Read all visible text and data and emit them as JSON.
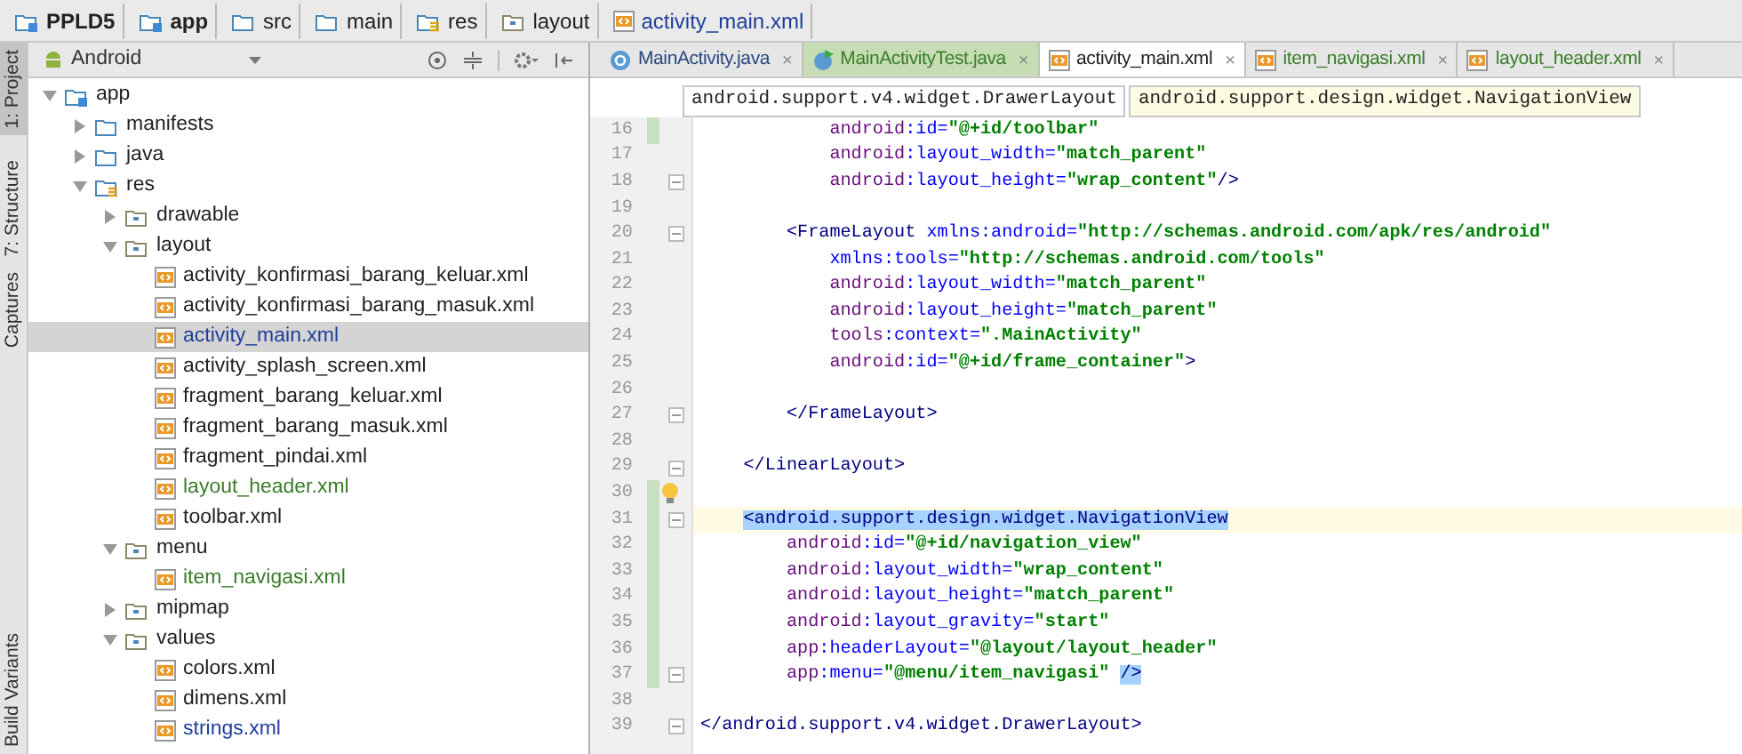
{
  "breadcrumb": [
    {
      "label": "PPLD5",
      "kind": "module"
    },
    {
      "label": "app",
      "kind": "module"
    },
    {
      "label": "src",
      "kind": "folder"
    },
    {
      "label": "main",
      "kind": "folder"
    },
    {
      "label": "res",
      "kind": "resdir"
    },
    {
      "label": "layout",
      "kind": "subdir"
    },
    {
      "label": "activity_main.xml",
      "kind": "xml"
    }
  ],
  "tool_strip": [
    {
      "label": "1: Project",
      "selected": true
    },
    {
      "label": "7: Structure",
      "selected": false
    },
    {
      "label": "Captures",
      "selected": false
    },
    {
      "label": "Build Variants",
      "selected": false
    }
  ],
  "project_panel": {
    "view": "Android",
    "tree": [
      {
        "label": "app",
        "kind": "module",
        "expanded": true,
        "selected": false,
        "color": "#222222",
        "children": [
          {
            "label": "manifests",
            "kind": "folder",
            "expanded": false,
            "selected": false,
            "color": "#222222"
          },
          {
            "label": "java",
            "kind": "folder",
            "expanded": false,
            "selected": false,
            "color": "#222222"
          },
          {
            "label": "res",
            "kind": "resdir",
            "expanded": true,
            "selected": false,
            "color": "#222222",
            "children": [
              {
                "label": "drawable",
                "kind": "subdir",
                "expanded": false,
                "selected": false,
                "color": "#222222"
              },
              {
                "label": "layout",
                "kind": "subdir",
                "expanded": true,
                "selected": false,
                "color": "#222222",
                "children": [
                  {
                    "label": "activity_konfirmasi_barang_keluar.xml",
                    "kind": "xml",
                    "selected": false,
                    "color": "#222222"
                  },
                  {
                    "label": "activity_konfirmasi_barang_masuk.xml",
                    "kind": "xml",
                    "selected": false,
                    "color": "#222222"
                  },
                  {
                    "label": "activity_main.xml",
                    "kind": "xml",
                    "selected": true,
                    "color": "#1f3f9b"
                  },
                  {
                    "label": "activity_splash_screen.xml",
                    "kind": "xml",
                    "selected": false,
                    "color": "#222222"
                  },
                  {
                    "label": "fragment_barang_keluar.xml",
                    "kind": "xml",
                    "selected": false,
                    "color": "#222222"
                  },
                  {
                    "label": "fragment_barang_masuk.xml",
                    "kind": "xml",
                    "selected": false,
                    "color": "#222222"
                  },
                  {
                    "label": "fragment_pindai.xml",
                    "kind": "xml",
                    "selected": false,
                    "color": "#222222"
                  },
                  {
                    "label": "layout_header.xml",
                    "kind": "xml",
                    "selected": false,
                    "color": "#3a7d2a"
                  },
                  {
                    "label": "toolbar.xml",
                    "kind": "xml",
                    "selected": false,
                    "color": "#222222"
                  }
                ]
              },
              {
                "label": "menu",
                "kind": "subdir",
                "expanded": true,
                "selected": false,
                "color": "#222222",
                "children": [
                  {
                    "label": "item_navigasi.xml",
                    "kind": "xml",
                    "selected": false,
                    "color": "#3a7d2a"
                  }
                ]
              },
              {
                "label": "mipmap",
                "kind": "subdir",
                "expanded": false,
                "selected": false,
                "color": "#222222"
              },
              {
                "label": "values",
                "kind": "subdir",
                "expanded": true,
                "selected": false,
                "color": "#222222",
                "children": [
                  {
                    "label": "colors.xml",
                    "kind": "xml",
                    "selected": false,
                    "color": "#222222"
                  },
                  {
                    "label": "dimens.xml",
                    "kind": "xml",
                    "selected": false,
                    "color": "#222222"
                  },
                  {
                    "label": "strings.xml",
                    "kind": "xml",
                    "selected": false,
                    "color": "#1f3f9b"
                  }
                ]
              }
            ]
          }
        ]
      }
    ]
  },
  "editor_tabs": [
    {
      "label": "MainActivity.java",
      "kind": "class",
      "color": "#2a4a80",
      "close": "×",
      "selected": false
    },
    {
      "label": "MainActivityTest.java",
      "kind": "test",
      "color": "#3a7d2a",
      "close": "×",
      "selected": false
    },
    {
      "label": "activity_main.xml",
      "kind": "xml",
      "color": "#222222",
      "close": "×",
      "selected": true
    },
    {
      "label": "item_navigasi.xml",
      "kind": "xml",
      "color": "#3a7d2a",
      "close": "×",
      "selected": false
    },
    {
      "label": "layout_header.xml",
      "kind": "xml",
      "color": "#3a7d2a",
      "close": "×",
      "selected": false
    }
  ],
  "tag_path": [
    {
      "label": "android.support.v4.widget.DrawerLayout",
      "selected": false
    },
    {
      "label": "android.support.design.widget.NavigationView",
      "selected": true
    }
  ],
  "code_lines": [
    {
      "number": "16",
      "changed": true,
      "fold": false,
      "current": false,
      "bulb": false,
      "tokens": [
        {
          "kind": "ns",
          "text": "            android",
          "selected": false
        },
        {
          "kind": "attr",
          "text": ":id=",
          "selected": false
        },
        {
          "kind": "value",
          "text": "\"@+id/toolbar\"",
          "selected": false
        }
      ]
    },
    {
      "number": "17",
      "changed": false,
      "fold": false,
      "current": false,
      "bulb": false,
      "tokens": [
        {
          "kind": "ns",
          "text": "            android",
          "selected": false
        },
        {
          "kind": "attr",
          "text": ":layout_width=",
          "selected": false
        },
        {
          "kind": "value",
          "text": "\"match_parent\"",
          "selected": false
        }
      ]
    },
    {
      "number": "18",
      "changed": false,
      "fold": true,
      "current": false,
      "bulb": false,
      "tokens": [
        {
          "kind": "ns",
          "text": "            android",
          "selected": false
        },
        {
          "kind": "attr",
          "text": ":layout_height=",
          "selected": false
        },
        {
          "kind": "value",
          "text": "\"wrap_content\"",
          "selected": false
        },
        {
          "kind": "tag",
          "text": "/>",
          "selected": false
        }
      ]
    },
    {
      "number": "19",
      "changed": false,
      "fold": false,
      "current": false,
      "bulb": false
    },
    {
      "number": "20",
      "changed": false,
      "fold": true,
      "current": false,
      "bulb": false,
      "tokens": [
        {
          "kind": "tag",
          "text": "        <FrameLayout ",
          "selected": false
        },
        {
          "kind": "attr",
          "text": "xmlns:android=",
          "selected": false
        },
        {
          "kind": "value",
          "text": "\"http://schemas.android.com/apk/res/android\"",
          "selected": false
        }
      ]
    },
    {
      "number": "21",
      "changed": false,
      "fold": false,
      "current": false,
      "bulb": false,
      "tokens": [
        {
          "kind": "attr",
          "text": "            xmlns:tools=",
          "selected": false
        },
        {
          "kind": "value",
          "text": "\"http://schemas.android.com/tools\"",
          "selected": false
        }
      ]
    },
    {
      "number": "22",
      "changed": false,
      "fold": false,
      "current": false,
      "bulb": false,
      "tokens": [
        {
          "kind": "ns",
          "text": "            android",
          "selected": false
        },
        {
          "kind": "attr",
          "text": ":layout_width=",
          "selected": false
        },
        {
          "kind": "value",
          "text": "\"match_parent\"",
          "selected": false
        }
      ]
    },
    {
      "number": "23",
      "changed": false,
      "fold": false,
      "current": false,
      "bulb": false,
      "tokens": [
        {
          "kind": "ns",
          "text": "            android",
          "selected": false
        },
        {
          "kind": "attr",
          "text": ":layout_height=",
          "selected": false
        },
        {
          "kind": "value",
          "text": "\"match_parent\"",
          "selected": false
        }
      ]
    },
    {
      "number": "24",
      "changed": false,
      "fold": false,
      "current": false,
      "bulb": false,
      "tokens": [
        {
          "kind": "ns",
          "text": "            tools",
          "selected": false
        },
        {
          "kind": "attr",
          "text": ":context=",
          "selected": false
        },
        {
          "kind": "value",
          "text": "\".MainActivity\"",
          "selected": false
        }
      ]
    },
    {
      "number": "25",
      "changed": false,
      "fold": false,
      "current": false,
      "bulb": false,
      "tokens": [
        {
          "kind": "ns",
          "text": "            android",
          "selected": false
        },
        {
          "kind": "attr",
          "text": ":id=",
          "selected": false
        },
        {
          "kind": "value",
          "text": "\"@+id/frame_container\"",
          "selected": false
        },
        {
          "kind": "tag",
          "text": ">",
          "selected": false
        }
      ]
    },
    {
      "number": "26",
      "changed": false,
      "fold": false,
      "current": false,
      "bulb": false
    },
    {
      "number": "27",
      "changed": false,
      "fold": true,
      "current": false,
      "bulb": false,
      "tokens": [
        {
          "kind": "tag",
          "text": "        </FrameLayout>",
          "selected": false
        }
      ]
    },
    {
      "number": "28",
      "changed": false,
      "fold": false,
      "current": false,
      "bulb": false
    },
    {
      "number": "29",
      "changed": false,
      "fold": true,
      "current": false,
      "bulb": false,
      "tokens": [
        {
          "kind": "tag",
          "text": "    </LinearLayout>",
          "selected": false
        }
      ]
    },
    {
      "number": "30",
      "changed": true,
      "fold": false,
      "current": false,
      "bulb": true
    },
    {
      "number": "31",
      "changed": true,
      "fold": true,
      "current": true,
      "bulb": false,
      "tokens": [
        {
          "kind": "tag",
          "text": "    <android.support.design.widget.NavigationView",
          "selected": true
        }
      ]
    },
    {
      "number": "32",
      "changed": true,
      "fold": false,
      "current": false,
      "bulb": false,
      "tokens": [
        {
          "kind": "ns",
          "text": "        android",
          "selected": false
        },
        {
          "kind": "attr",
          "text": ":id=",
          "selected": false
        },
        {
          "kind": "value",
          "text": "\"@+id/navigation_view\"",
          "selected": false
        }
      ]
    },
    {
      "number": "33",
      "changed": true,
      "fold": false,
      "current": false,
      "bulb": false,
      "tokens": [
        {
          "kind": "ns",
          "text": "        android",
          "selected": false
        },
        {
          "kind": "attr",
          "text": ":layout_width=",
          "selected": false
        },
        {
          "kind": "value",
          "text": "\"wrap_content\"",
          "selected": false
        }
      ]
    },
    {
      "number": "34",
      "changed": true,
      "fold": false,
      "current": false,
      "bulb": false,
      "tokens": [
        {
          "kind": "ns",
          "text": "        android",
          "selected": false
        },
        {
          "kind": "attr",
          "text": ":layout_height=",
          "selected": false
        },
        {
          "kind": "value",
          "text": "\"match_parent\"",
          "selected": false
        }
      ]
    },
    {
      "number": "35",
      "changed": true,
      "fold": false,
      "current": false,
      "bulb": false,
      "tokens": [
        {
          "kind": "ns",
          "text": "        android",
          "selected": false
        },
        {
          "kind": "attr",
          "text": ":layout_gravity=",
          "selected": false
        },
        {
          "kind": "value",
          "text": "\"start\"",
          "selected": false
        }
      ]
    },
    {
      "number": "36",
      "changed": true,
      "fold": false,
      "current": false,
      "bulb": false,
      "tokens": [
        {
          "kind": "ns",
          "text": "        app",
          "selected": false
        },
        {
          "kind": "attr",
          "text": ":headerLayout=",
          "selected": false
        },
        {
          "kind": "value",
          "text": "\"@layout/layout_header\"",
          "selected": false
        }
      ]
    },
    {
      "number": "37",
      "changed": true,
      "fold": true,
      "current": false,
      "bulb": false,
      "tokens": [
        {
          "kind": "ns",
          "text": "        app",
          "selected": false
        },
        {
          "kind": "attr",
          "text": ":menu=",
          "selected": false
        },
        {
          "kind": "value",
          "text": "\"@menu/item_navigasi\"",
          "selected": false
        },
        {
          "kind": "tag",
          "text": " />",
          "selected": true
        }
      ]
    },
    {
      "number": "38",
      "changed": false,
      "fold": false,
      "current": false,
      "bulb": false
    },
    {
      "number": "39",
      "changed": false,
      "fold": true,
      "current": false,
      "bulb": false,
      "tokens": [
        {
          "kind": "tag",
          "text": "</android.support.v4.widget.DrawerLayout>",
          "selected": false
        }
      ]
    }
  ]
}
